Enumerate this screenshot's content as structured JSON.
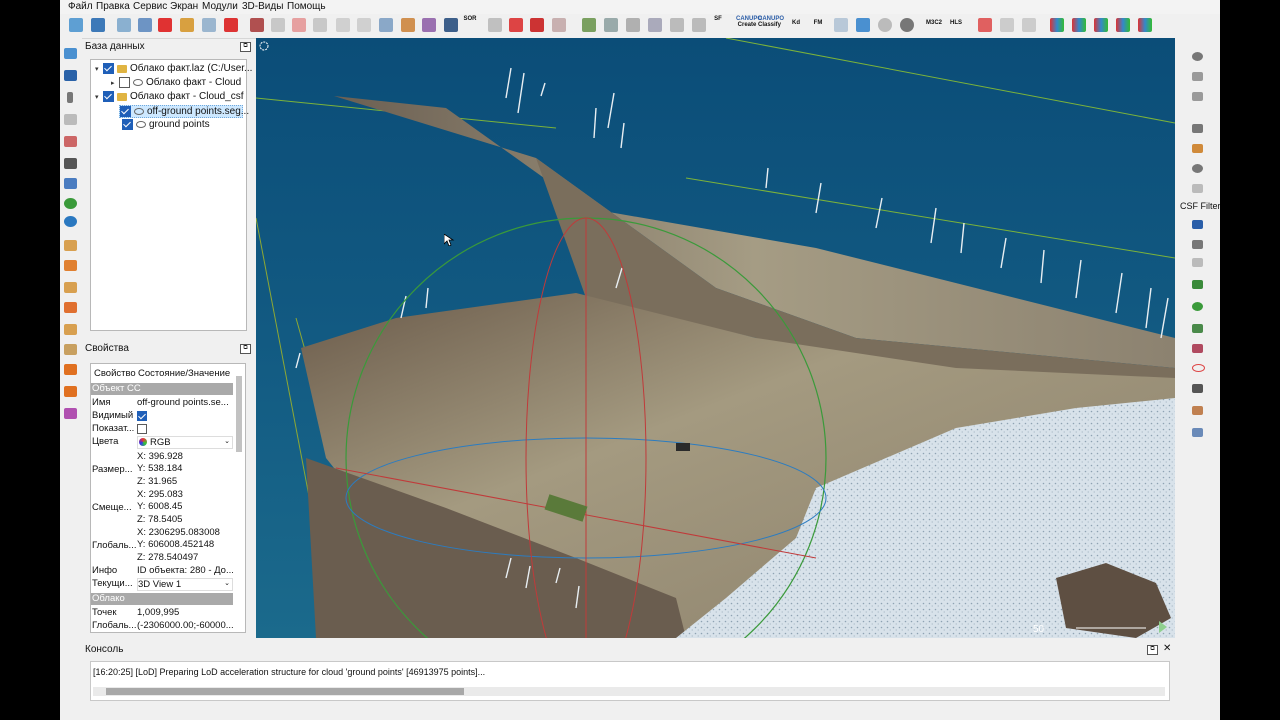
{
  "menu": [
    "Файл",
    "Правка",
    "Сервис",
    "Экран",
    "Модули",
    "3D-Виды",
    "Помощь"
  ],
  "toolbar": {
    "sor_label": "SOR",
    "sf_label": "SF",
    "canupo_create_top": "CANUPO",
    "canupo_create_bottom": "Create",
    "canupo_classify_top": "CANUPO",
    "canupo_classify_bottom": "Classify",
    "kd_label": "Kd",
    "fm_label": "FM",
    "m3c2_label": "M3C2",
    "hls_label": "HLS"
  },
  "db_panel": {
    "title": "База данных",
    "items": [
      {
        "label": "Облако факт.laz (C:/User...",
        "checked": true,
        "kind": "folder",
        "expanded": true
      },
      {
        "label": "Облако факт - Cloud",
        "checked": false,
        "kind": "cloud",
        "expanded": false
      },
      {
        "label": "Облако факт - Cloud_csf",
        "checked": true,
        "kind": "folder",
        "expanded": true
      },
      {
        "label": "off-ground points.seg...",
        "checked": true,
        "kind": "cloud",
        "selected": true
      },
      {
        "label": "ground points",
        "checked": true,
        "kind": "cloud"
      }
    ]
  },
  "props_panel": {
    "title": "Свойства",
    "col_property": "Свойство",
    "col_value": "Состояние/Значение",
    "section_object": "Объект CC",
    "name_label": "Имя",
    "name_value": "off-ground points.se...",
    "visible_label": "Видимый",
    "visible": true,
    "show_label": "Показат...",
    "show": false,
    "colors_label": "Цвета",
    "colors_value": "RGB",
    "size_label": "Размер...",
    "size_x": "X: 396.928",
    "size_y": "Y: 538.184",
    "size_z": "Z: 31.965",
    "shift_label": "Смеще...",
    "shift_x": "X: 295.083",
    "shift_y": "Y: 6008.45",
    "shift_z": "Z: 78.5405",
    "global_label": "Глобаль...",
    "global_x": "X: 2306295.083008",
    "global_y": "Y: 606008.452148",
    "global_z": "Z: 278.540497",
    "info_label": "Инфо",
    "info_value": "ID объекта: 280 - До...",
    "current_label": "Текущи...",
    "current_value": "3D View 1",
    "section_cloud": "Облако",
    "points_label": "Точек",
    "points_value": "1,009,995",
    "global2_label": "Глобаль...",
    "global2_value": "(-2306000.00;-60000..."
  },
  "view": {
    "scale_label": "50"
  },
  "right_toolbar": {
    "csf_label": "CSF Filter"
  },
  "console": {
    "title": "Консоль",
    "line": "[16:20:25] [LoD] Preparing LoD acceleration structure for cloud 'ground points' [46913975 points]..."
  },
  "colors": {
    "selection": "#cde8ff",
    "checkbox": "#1f5fb8",
    "section_header": "#a9a9a9",
    "view_bg": "#0f4a6e"
  }
}
